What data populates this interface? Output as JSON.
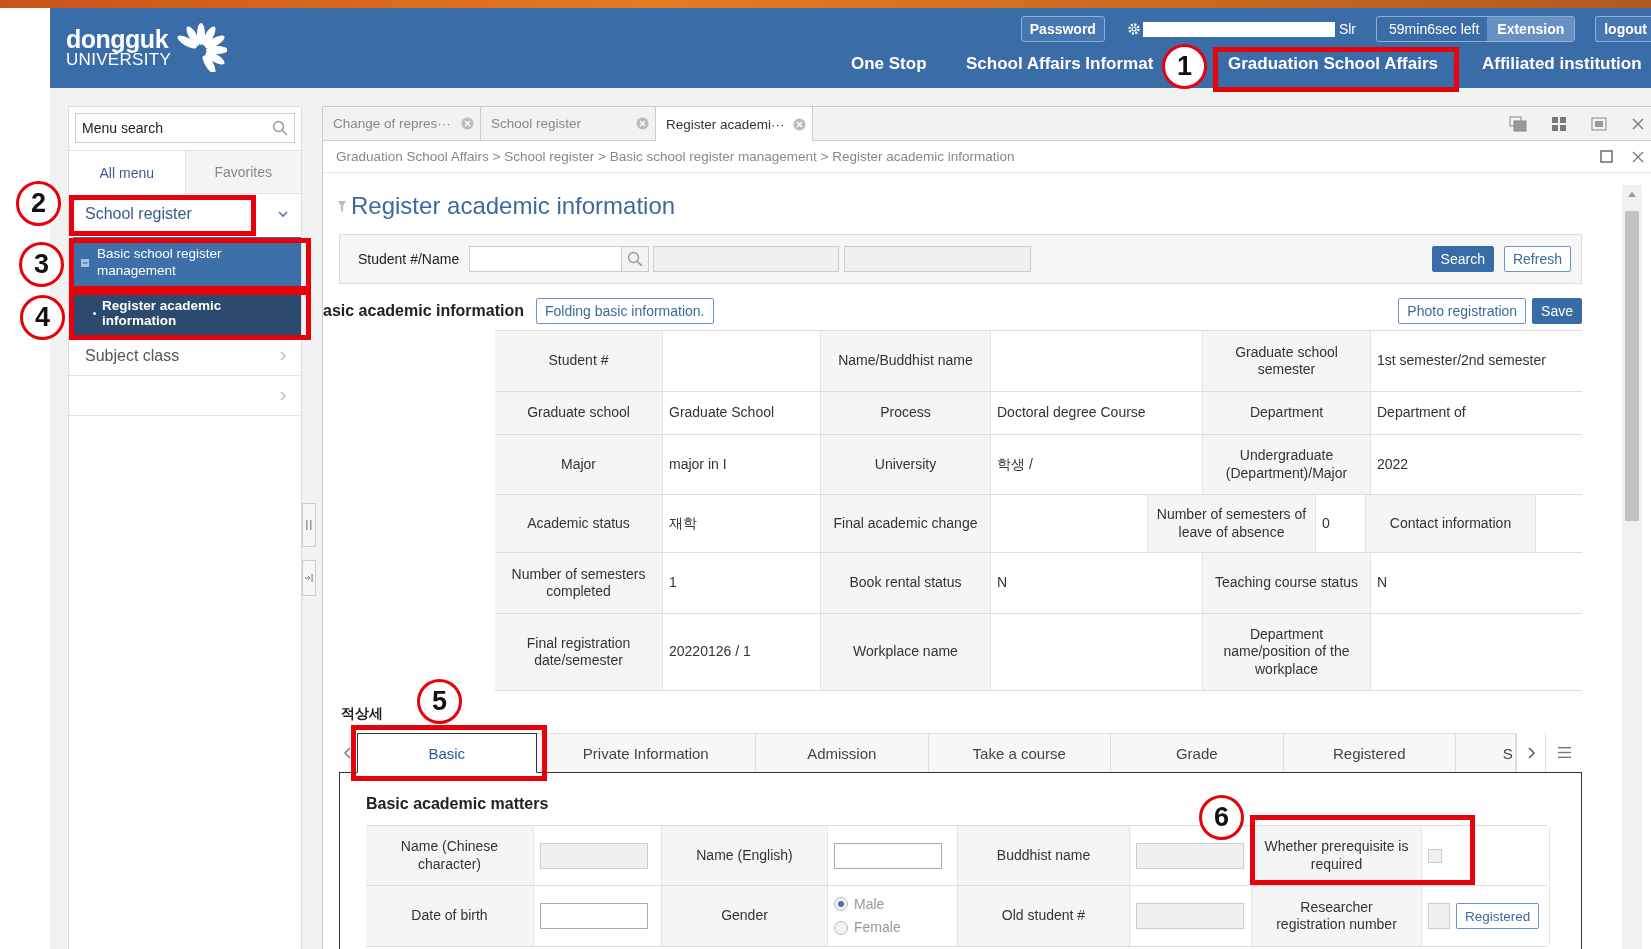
{
  "header": {
    "logo_name": "dongguk",
    "logo_subtitle": "UNIVERSITY",
    "password_button": "Password",
    "user_suffix": "Slr",
    "timer": "59min6sec left",
    "extension_button": "Extension",
    "logout_button": "logout",
    "nav": [
      "One Stop",
      "School Affairs Informat",
      "Graduation School Affairs",
      "Affiliated institution"
    ]
  },
  "sidebar": {
    "search_placeholder": "Menu search",
    "tabs": [
      {
        "label": "All menu",
        "selected": true
      },
      {
        "label": "Favorites",
        "selected": false
      }
    ],
    "menu": [
      {
        "label": "School register",
        "expanded": true,
        "selected": false,
        "children": [
          {
            "label": "Basic school register management",
            "expanded": true,
            "selected": false,
            "children": [
              {
                "label": "Register academic information",
                "selected": true
              }
            ]
          }
        ]
      },
      {
        "label": "Subject class",
        "expanded": false,
        "selected": false
      },
      {
        "expanded": false,
        "selected": false
      }
    ]
  },
  "tabs": [
    {
      "label": "Change of repres···",
      "selected": false
    },
    {
      "label": "School register",
      "selected": false
    },
    {
      "label": "Register academi···",
      "selected": true
    }
  ],
  "breadcrumb": "Graduation School Affairs > School register > Basic school register management > Register academic information",
  "page_title": "Register academic information",
  "search": {
    "label": "Student #/Name",
    "buttons": [
      {
        "label": "Search",
        "kind": "primary"
      },
      {
        "label": "Refresh",
        "kind": "outline"
      }
    ]
  },
  "section": {
    "title": "asic academic information",
    "fold_button": "Folding basic information.",
    "buttons": [
      {
        "label": "Photo registration",
        "kind": "outline"
      },
      {
        "label": "Save",
        "kind": "primary"
      }
    ]
  },
  "info_rows": [
    {
      "cells": [
        {
          "kind": "label",
          "text": "Student #"
        },
        {
          "kind": "value"
        },
        {
          "kind": "label",
          "text": "Name/Buddhist name"
        },
        {
          "kind": "value"
        },
        {
          "kind": "label",
          "text": "Graduate school semester"
        },
        {
          "kind": "value",
          "text": "1st semester/2nd semester"
        }
      ]
    },
    {
      "cells": [
        {
          "kind": "label",
          "text": "Graduate school"
        },
        {
          "kind": "value",
          "text": "Graduate School"
        },
        {
          "kind": "label",
          "text": "Process"
        },
        {
          "kind": "value",
          "text": "Doctoral degree Course"
        },
        {
          "kind": "label",
          "text": "Department"
        },
        {
          "kind": "value",
          "text": "Department of"
        }
      ]
    },
    {
      "cells": [
        {
          "kind": "label",
          "text": "Major"
        },
        {
          "kind": "value",
          "text": "major in I"
        },
        {
          "kind": "label",
          "text": "University"
        },
        {
          "kind": "value",
          "text": "학생 /"
        },
        {
          "kind": "label",
          "text": "Undergraduate (Department)/Major"
        },
        {
          "kind": "value",
          "text": "2022"
        }
      ]
    },
    {
      "cells": [
        {
          "kind": "label",
          "text": "Academic status"
        },
        {
          "kind": "value",
          "text": "재학"
        },
        {
          "kind": "label",
          "text": "Final academic change"
        },
        {
          "kind": "value"
        },
        {
          "kind": "label",
          "text": "Number of semesters of leave of absence"
        },
        {
          "kind": "value",
          "text": "0"
        },
        {
          "kind": "label",
          "text": "Contact information"
        },
        {
          "kind": "value"
        }
      ]
    },
    {
      "cells": [
        {
          "kind": "label",
          "text": "Number of semesters completed"
        },
        {
          "kind": "value",
          "text": "1"
        },
        {
          "kind": "label",
          "text": "Book rental status"
        },
        {
          "kind": "value",
          "text": "N"
        },
        {
          "kind": "label",
          "text": "Teaching course status"
        },
        {
          "kind": "value",
          "text": "N"
        }
      ]
    },
    {
      "cells": [
        {
          "kind": "label",
          "text": "Final registration date/semester"
        },
        {
          "kind": "value",
          "text": "20220126 / 1"
        },
        {
          "kind": "label",
          "text": "Workplace name"
        },
        {
          "kind": "value"
        },
        {
          "kind": "label",
          "text": "Department name/position of the workplace"
        },
        {
          "kind": "value"
        }
      ]
    }
  ],
  "detail_heading": "적상세",
  "detail_tabs": [
    {
      "label": "Basic",
      "selected": true
    },
    {
      "label": "Private Information",
      "selected": false
    },
    {
      "label": "Admission",
      "selected": false
    },
    {
      "label": "Take a course",
      "selected": false
    },
    {
      "label": "Grade",
      "selected": false
    },
    {
      "label": "Registered",
      "selected": false
    },
    {
      "label": "S",
      "selected": false
    }
  ],
  "matters": {
    "title": "Basic academic matters",
    "rows": [
      {
        "cells": [
          {
            "kind": "label",
            "text": "Name (Chinese character)"
          },
          {
            "kind": "input",
            "disabled": true
          },
          {
            "kind": "label",
            "text": "Name (English)"
          },
          {
            "kind": "input",
            "disabled": false
          },
          {
            "kind": "label",
            "text": "Buddhist name"
          },
          {
            "kind": "input",
            "disabled": true
          },
          {
            "kind": "label",
            "text": "Whether prerequisite is required"
          },
          {
            "kind": "checkbox",
            "checked": false
          }
        ]
      },
      {
        "cells": [
          {
            "kind": "label",
            "text": "Date of birth"
          },
          {
            "kind": "input",
            "disabled": false
          },
          {
            "kind": "label",
            "text": "Gender"
          },
          {
            "kind": "radio",
            "options": [
              {
                "label": "Male",
                "selected": true
              },
              {
                "label": "Female",
                "selected": false
              }
            ]
          },
          {
            "kind": "label",
            "text": "Old student #"
          },
          {
            "kind": "input",
            "disabled": true
          },
          {
            "kind": "label",
            "text": "Researcher registration number"
          },
          {
            "kind": "input_button",
            "button": "Registered"
          }
        ]
      }
    ]
  },
  "annotations": [
    "1",
    "2",
    "3",
    "4",
    "5",
    "6"
  ]
}
